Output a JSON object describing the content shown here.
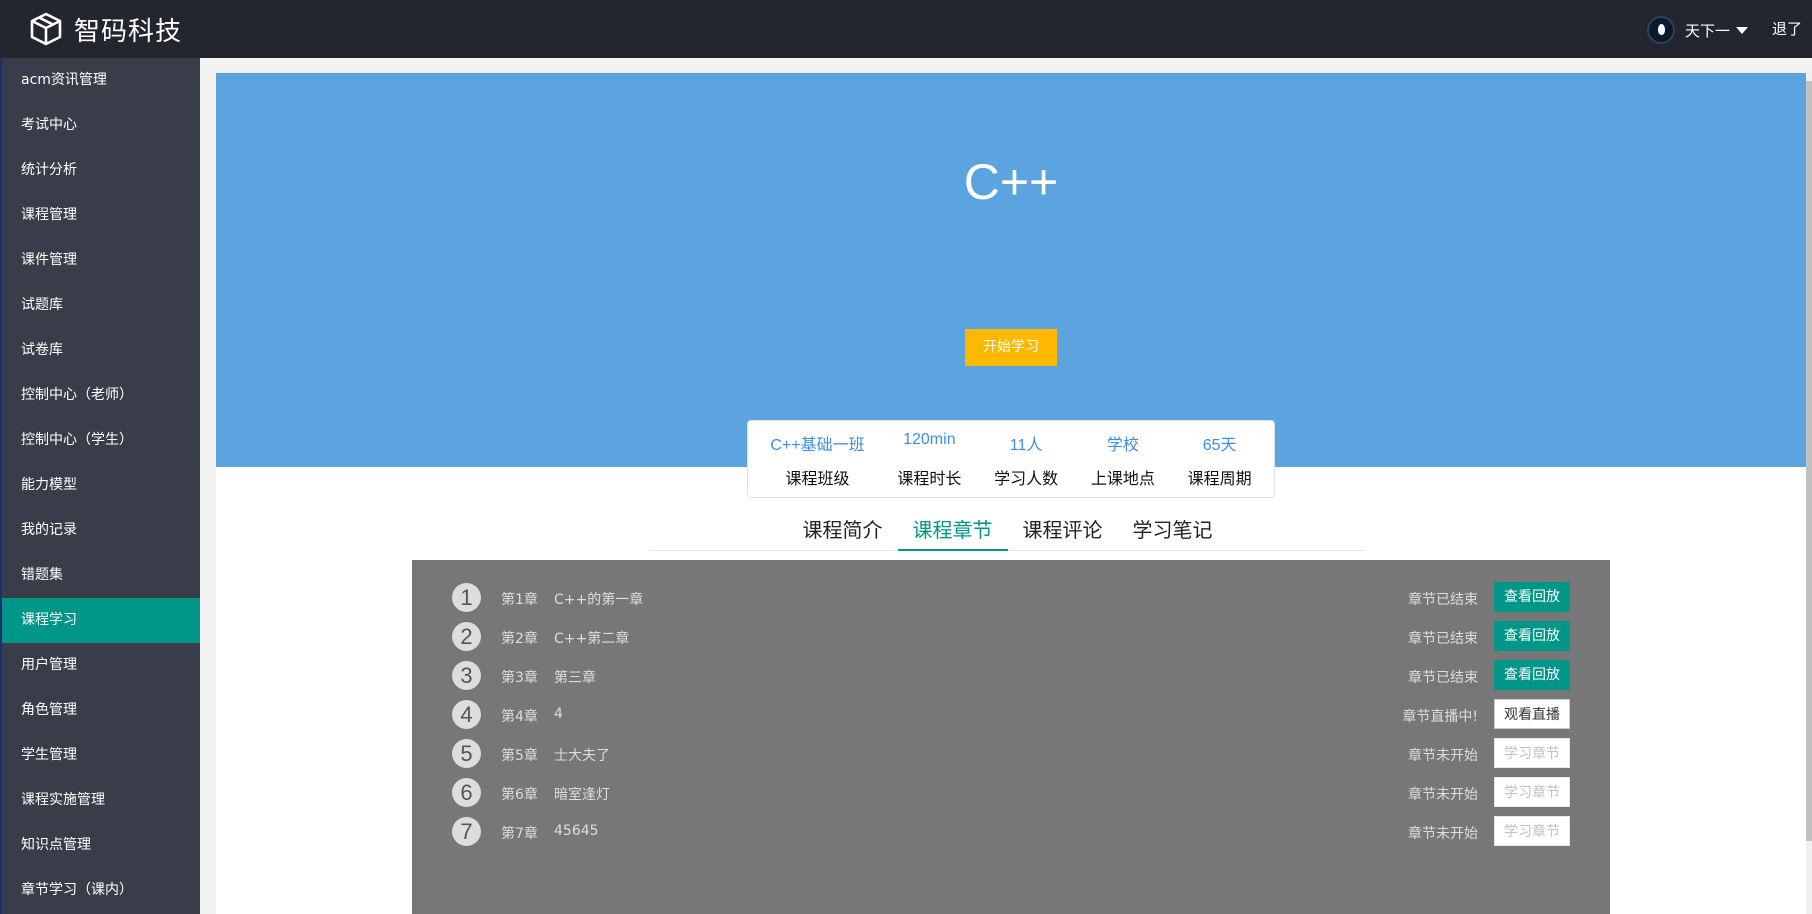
{
  "app": {
    "title": "智码科技"
  },
  "user": {
    "name": "天下一",
    "logout": "退了"
  },
  "sidebar": {
    "items": [
      {
        "label": "acm资讯管理"
      },
      {
        "label": "考试中心"
      },
      {
        "label": "统计分析"
      },
      {
        "label": "课程管理"
      },
      {
        "label": "课件管理"
      },
      {
        "label": "试题库"
      },
      {
        "label": "试卷库"
      },
      {
        "label": "控制中心（老师）"
      },
      {
        "label": "控制中心（学生）"
      },
      {
        "label": "能力模型"
      },
      {
        "label": "我的记录"
      },
      {
        "label": "错题集"
      },
      {
        "label": "课程学习",
        "active": true
      },
      {
        "label": "用户管理"
      },
      {
        "label": "角色管理"
      },
      {
        "label": "学生管理"
      },
      {
        "label": "课程实施管理"
      },
      {
        "label": "知识点管理"
      },
      {
        "label": "章节学习（课内）"
      }
    ]
  },
  "course": {
    "title": "C++",
    "start_label": "开始学习",
    "info": [
      {
        "value": "C++基础一班",
        "label": "课程班级"
      },
      {
        "value": "120min",
        "label": "课程时长"
      },
      {
        "value": "11人",
        "label": "学习人数"
      },
      {
        "value": "学校",
        "label": "上课地点"
      },
      {
        "value": "65天",
        "label": "课程周期"
      }
    ]
  },
  "tabs": [
    {
      "label": "课程简介"
    },
    {
      "label": "课程章节",
      "active": true
    },
    {
      "label": "课程评论"
    },
    {
      "label": "学习笔记"
    }
  ],
  "chapters": [
    {
      "num": "1",
      "index": "第1章",
      "name": "C++的第一章",
      "status": "章节已结束",
      "button": "查看回放",
      "kind": "replay"
    },
    {
      "num": "2",
      "index": "第2章",
      "name": "C++第二章",
      "status": "章节已结束",
      "button": "查看回放",
      "kind": "replay"
    },
    {
      "num": "3",
      "index": "第3章",
      "name": "第三章",
      "status": "章节已结束",
      "button": "查看回放",
      "kind": "replay"
    },
    {
      "num": "4",
      "index": "第4章",
      "name": "4",
      "status": "章节直播中!",
      "button": "观看直播",
      "kind": "live"
    },
    {
      "num": "5",
      "index": "第5章",
      "name": "士大夫了",
      "status": "章节未开始",
      "button": "学习章节",
      "kind": "study"
    },
    {
      "num": "6",
      "index": "第6章",
      "name": "暗室逢灯",
      "status": "章节未开始",
      "button": "学习章节",
      "kind": "study"
    },
    {
      "num": "7",
      "index": "第7章",
      "name": "45645",
      "status": "章节未开始",
      "button": "学习章节",
      "kind": "study"
    }
  ],
  "colors": {
    "topbar": "#23262e",
    "sidebar": "#393d49",
    "accent": "#009688",
    "hero": "#5ba4e0",
    "start_button": "#ffb800"
  }
}
